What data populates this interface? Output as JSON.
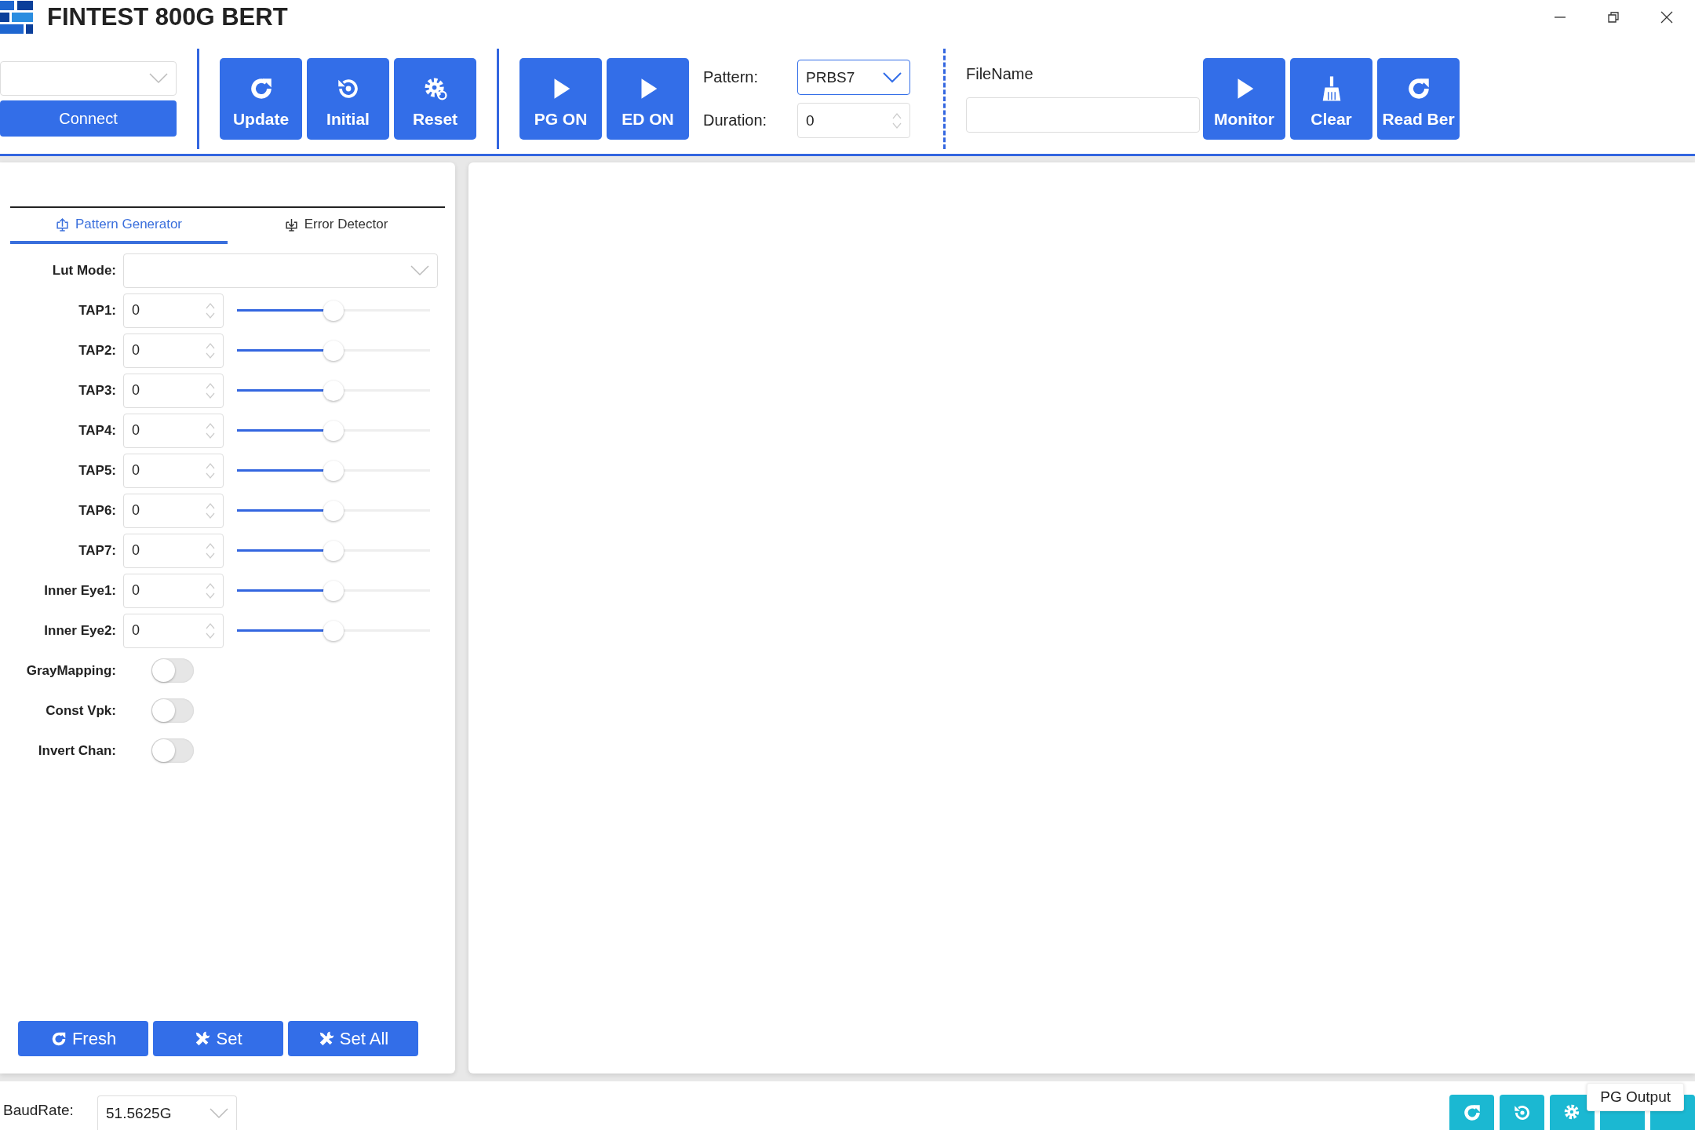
{
  "window": {
    "title": "FINTEST 800G BERT"
  },
  "connection": {
    "connect_button": "Connect"
  },
  "toolbar": {
    "groups": [
      [
        {
          "label": "Update"
        },
        {
          "label": "Initial"
        },
        {
          "label": "Reset"
        }
      ],
      [
        {
          "label": "PG ON"
        },
        {
          "label": "ED ON"
        }
      ]
    ],
    "pattern": {
      "label": "Pattern:",
      "value": "PRBS7"
    },
    "duration": {
      "label": "Duration:",
      "value": "0"
    },
    "filename": {
      "label": "FileName"
    },
    "monitor_buttons": [
      {
        "label": "Monitor"
      },
      {
        "label": "Clear"
      },
      {
        "label": "Read Ber"
      }
    ]
  },
  "left_panel": {
    "tabs": [
      {
        "label": "Pattern Generator",
        "selected": true
      },
      {
        "label": "Error Detector",
        "selected": false
      }
    ],
    "lut_mode": {
      "label": "Lut Mode:"
    },
    "sliders": [
      {
        "label": "TAP1:",
        "value": "0",
        "level": 0.5
      },
      {
        "label": "TAP2:",
        "value": "0",
        "level": 0.5
      },
      {
        "label": "TAP3:",
        "value": "0",
        "level": 0.5
      },
      {
        "label": "TAP4:",
        "value": "0",
        "level": 0.5
      },
      {
        "label": "TAP5:",
        "value": "0",
        "level": 0.5
      },
      {
        "label": "TAP6:",
        "value": "0",
        "level": 0.5
      },
      {
        "label": "TAP7:",
        "value": "0",
        "level": 0.5
      },
      {
        "label": "Inner Eye1:",
        "value": "0",
        "level": 0.5
      },
      {
        "label": "Inner Eye2:",
        "value": "0",
        "level": 0.5
      }
    ],
    "toggles": [
      {
        "label": "GrayMapping:",
        "on": false
      },
      {
        "label": "Const Vpk:",
        "on": false
      },
      {
        "label": "Invert Chan:",
        "on": false
      }
    ],
    "buttons": [
      {
        "label": "Fresh"
      },
      {
        "label": "Set"
      },
      {
        "label": "Set All"
      }
    ]
  },
  "status_bar": {
    "baud_rate": {
      "label": "BaudRate:",
      "value": "51.5625G"
    },
    "tooltip": "PG Output"
  }
}
